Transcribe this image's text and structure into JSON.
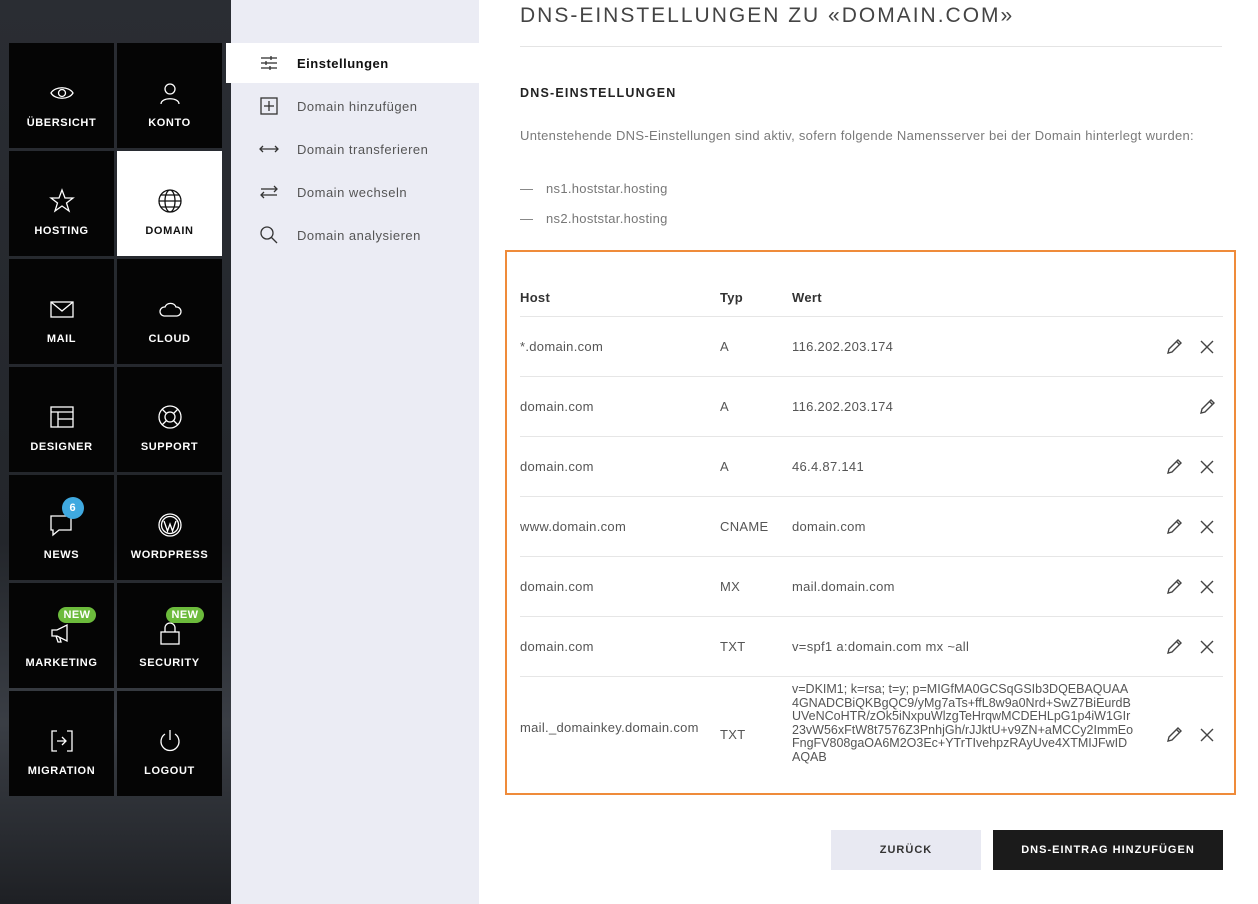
{
  "nav": {
    "tiles": [
      {
        "label": "ÜBERSICHT",
        "icon": "eye-icon"
      },
      {
        "label": "KONTO",
        "icon": "user-icon"
      },
      {
        "label": "HOSTING",
        "icon": "star-icon"
      },
      {
        "label": "DOMAIN",
        "icon": "globe-icon"
      },
      {
        "label": "MAIL",
        "icon": "envelope-icon"
      },
      {
        "label": "CLOUD",
        "icon": "cloud-icon"
      },
      {
        "label": "DESIGNER",
        "icon": "layout-icon"
      },
      {
        "label": "SUPPORT",
        "icon": "lifebuoy-icon"
      },
      {
        "label": "NEWS",
        "icon": "chat-icon",
        "badge": "6"
      },
      {
        "label": "WORDPRESS",
        "icon": "wordpress-icon"
      },
      {
        "label": "MARKETING",
        "icon": "megaphone-icon",
        "badge": "NEW"
      },
      {
        "label": "SECURITY",
        "icon": "lock-icon",
        "badge": "NEW"
      },
      {
        "label": "MIGRATION",
        "icon": "migration-icon"
      },
      {
        "label": "LOGOUT",
        "icon": "power-icon"
      }
    ],
    "active": "DOMAIN"
  },
  "submenu": {
    "items": [
      {
        "label": "Einstellungen",
        "icon": "sliders-icon"
      },
      {
        "label": "Domain hinzufügen",
        "icon": "plus-square-icon"
      },
      {
        "label": "Domain transferieren",
        "icon": "arrows-horizontal-icon"
      },
      {
        "label": "Domain wechseln",
        "icon": "swap-icon"
      },
      {
        "label": "Domain analysieren",
        "icon": "search-icon"
      }
    ]
  },
  "main": {
    "title": "DNS-EINSTELLUNGEN ZU «DOMAIN.COM»",
    "section_title": "DNS-EINSTELLUNGEN",
    "description": "Untenstehende DNS-Einstellungen sind aktiv, sofern folgende Namensserver bei der Domain hinterlegt wurden:",
    "nameservers": [
      "ns1.hoststar.hosting",
      "ns2.hoststar.hosting"
    ],
    "dash": "—",
    "table": {
      "headers": {
        "host": "Host",
        "typ": "Typ",
        "wert": "Wert"
      },
      "rows": [
        {
          "host": "*.domain.com",
          "typ": "A",
          "wert": "116.202.203.174",
          "deletable": true
        },
        {
          "host": "domain.com",
          "typ": "A",
          "wert": "116.202.203.174",
          "deletable": false
        },
        {
          "host": "domain.com",
          "typ": "A",
          "wert": "46.4.87.141",
          "deletable": true
        },
        {
          "host": "www.domain.com",
          "typ": "CNAME",
          "wert": "domain.com",
          "deletable": true
        },
        {
          "host": "domain.com",
          "typ": "MX",
          "wert": "mail.domain.com",
          "deletable": true
        },
        {
          "host": "domain.com",
          "typ": "TXT",
          "wert": "v=spf1 a:domain.com mx ~all",
          "deletable": true
        },
        {
          "host": "mail._domainkey.domain.com",
          "typ": "TXT",
          "wert": "v=DKIM1; k=rsa; t=y; p=MIGfMA0GCSqGSIb3DQEBAQUAA4GNADCBiQKBgQC9/yMg7aTs+ffL8w9a0Nrd+SwZ7BiEurdBUVeNCoHTR/zOk5iNxpuWlzgTeHrqwMCDEHLpG1p4iW1GIr23vW56xFtW8t7576Z3PnhjGh/rJJktU+v9ZN+aMCCy2ImmEoFngFV808gaOA6M2O3Ec+YTrTIvehpzRAyUve4XTMIJFwIDAQAB",
          "deletable": true
        }
      ]
    },
    "buttons": {
      "back": "ZURÜCK",
      "add": "DNS-EINTRAG HINZUFÜGEN"
    }
  }
}
